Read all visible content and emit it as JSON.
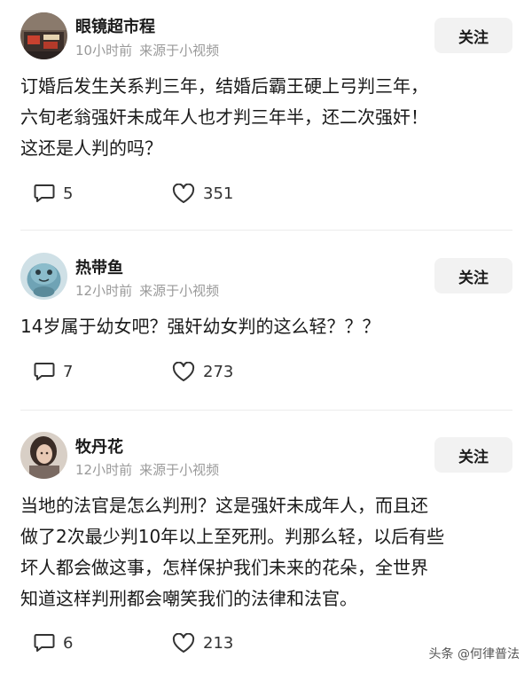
{
  "comments": [
    {
      "username": "眼镜超市程",
      "time": "10小时前",
      "source": "来源于小视频",
      "follow_label": "关注",
      "text_lines": [
        "订婚后发生关系判三年，结婚后霸王硬上弓判三年，",
        "六旬老翁强奸未成年人也才判三年半，还二次强奸！",
        "这还是人判的吗？"
      ],
      "reply_count": "5",
      "like_count": "351"
    },
    {
      "username": "热带鱼",
      "time": "12小时前",
      "source": "来源于小视频",
      "follow_label": "关注",
      "text_lines": [
        "14岁属于幼女吧？强奸幼女判的这么轻？？？"
      ],
      "reply_count": "7",
      "like_count": "273"
    },
    {
      "username": "牧丹花",
      "time": "12小时前",
      "source": "来源于小视频",
      "follow_label": "关注",
      "text_lines": [
        "当地的法官是怎么判刑？这是强奸未成年人，而且还",
        "做了2次最少判10年以上至死刑。判那么轻，以后有些",
        "坏人都会做这事，怎样保护我们未来的花朵，全世界",
        "知道这样判刑都会嘲笑我们的法律和法官。"
      ],
      "reply_count": "6",
      "like_count": "213"
    }
  ],
  "watermark": "头条 @何律普法",
  "icons": {
    "reply": "speech-bubble-icon",
    "like": "heart-icon"
  },
  "colors": {
    "text": "#1a1a1a",
    "meta": "#9a9a9a",
    "follow_bg": "#f2f2f2"
  }
}
